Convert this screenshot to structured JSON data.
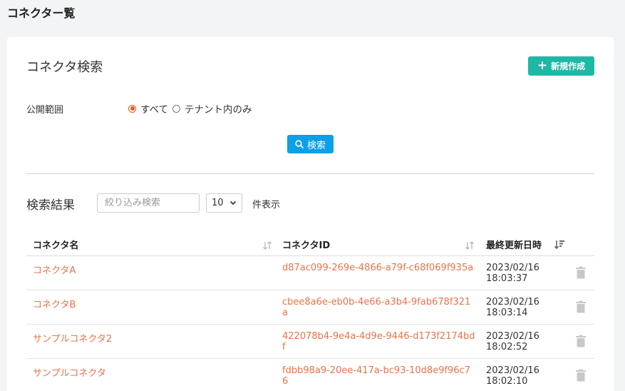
{
  "page": {
    "title": "コネクター覧"
  },
  "search": {
    "title": "コネクタ検索",
    "new_button_label": "新規作成",
    "scope_label": "公開範囲",
    "scope_options": [
      {
        "label": "すべて",
        "checked": true
      },
      {
        "label": "テナント内のみ",
        "checked": false
      }
    ],
    "search_button_label": "検索"
  },
  "results": {
    "title": "検索結果",
    "filter_placeholder": "絞り込み検索",
    "page_size": "10",
    "page_size_suffix": "件表示",
    "columns": [
      "コネクタ名",
      "コネクタID",
      "最終更新日時"
    ],
    "rows": [
      {
        "name": "コネクタA",
        "id": "d87ac099-269e-4866-a79f-c68f069f935a",
        "date": "2023/02/16",
        "time": "18:03:37"
      },
      {
        "name": "コネクタB",
        "id": "cbee8a6e-eb0b-4e66-a3b4-9fab678f321a",
        "date": "2023/02/16",
        "time": "18:03:14"
      },
      {
        "name": "サンプルコネクタ2",
        "id": "422078b4-9e4a-4d9e-9446-d173f2174bdf",
        "date": "2023/02/16",
        "time": "18:02:52"
      },
      {
        "name": "サンプルコネクタ",
        "id": "fdbb98a9-20ee-417a-bc93-10d8e9f96c76",
        "date": "2023/02/16",
        "time": "18:02:10"
      }
    ]
  },
  "colors": {
    "accent_green": "#1fb8a5",
    "accent_blue": "#0da0e6",
    "link_orange": "#e8734a",
    "radio_orange": "#e65a1a"
  },
  "icons": {
    "new": "plus-icon",
    "search": "magnifier-icon",
    "sort": "sort-icon",
    "delete": "trash-icon"
  }
}
